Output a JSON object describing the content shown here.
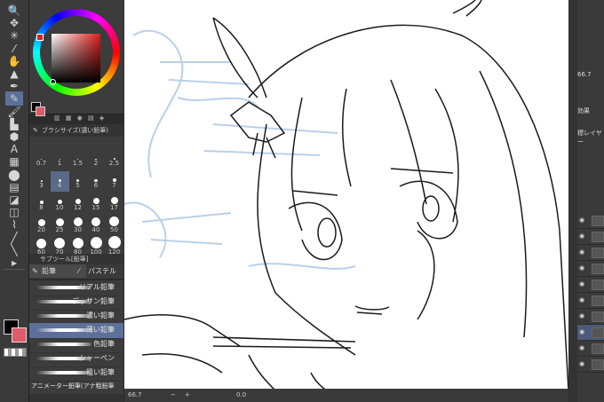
{
  "toolbar": {
    "tools": [
      {
        "name": "zoom-tool-icon",
        "glyph": "🔍"
      },
      {
        "name": "move-tool-icon",
        "glyph": "✥"
      },
      {
        "name": "magic-wand-icon",
        "glyph": "✳"
      },
      {
        "name": "eyedropper-icon",
        "glyph": "⁄"
      },
      {
        "name": "hand-tool-icon",
        "glyph": "✋"
      },
      {
        "name": "stamp-tool-icon",
        "glyph": "▲"
      },
      {
        "name": "pen-tool-icon",
        "glyph": "✒"
      },
      {
        "name": "pencil-tool-icon",
        "glyph": "✎"
      },
      {
        "name": "brush-tool-icon",
        "glyph": "🖌"
      },
      {
        "name": "airbrush-tool-icon",
        "glyph": "▙"
      },
      {
        "name": "eraser-tool-icon",
        "glyph": "⬢"
      },
      {
        "name": "text-tool-icon",
        "glyph": "A"
      },
      {
        "name": "fill-tool-icon",
        "glyph": "▦"
      },
      {
        "name": "blend-tool-icon",
        "glyph": "⬤"
      },
      {
        "name": "gradient-tool-icon",
        "glyph": "▤"
      },
      {
        "name": "figure-tool-icon",
        "glyph": "◪"
      },
      {
        "name": "balloon-tool-icon",
        "glyph": "◫"
      },
      {
        "name": "correction-tool-icon",
        "glyph": "⌇"
      },
      {
        "name": "ruler-tool-icon",
        "glyph": "╱"
      },
      {
        "name": "line-tool-icon",
        "glyph": "╲"
      },
      {
        "name": "operation-tool-icon",
        "glyph": "▸"
      }
    ]
  },
  "brush_size": {
    "title": "ブラシサイズ(濃い鉛筆)",
    "sizes": [
      "0.7",
      "1",
      "1.5",
      "2",
      "2.5",
      "3",
      "4",
      "5",
      "6",
      "7",
      "8",
      "10",
      "12",
      "15",
      "17",
      "20",
      "25",
      "30",
      "40",
      "50",
      "60",
      "70",
      "80",
      "100",
      "120"
    ]
  },
  "subtool": {
    "title": "サブツール[鉛筆]",
    "tab_pencil": "鉛筆",
    "tab_pastel": "パステル",
    "brushes": [
      "リアル鉛筆",
      "デッサン鉛筆",
      "濃い鉛筆",
      "薄い鉛筆",
      "色鉛筆",
      "シャーペン",
      "粗い鉛筆",
      "アニメーター鉛筆(アナ粗鉛筆"
    ],
    "selected_index": 3
  },
  "canvas": {
    "zoom": "66.7",
    "angle": "0.0"
  },
  "right_panel": {
    "zoom": "66.7",
    "effect_label": "効果",
    "layer_label": "標レイヤー"
  },
  "colors": {
    "main": "#000000",
    "sub": "#e05a6a",
    "accent": "#5d7099"
  }
}
